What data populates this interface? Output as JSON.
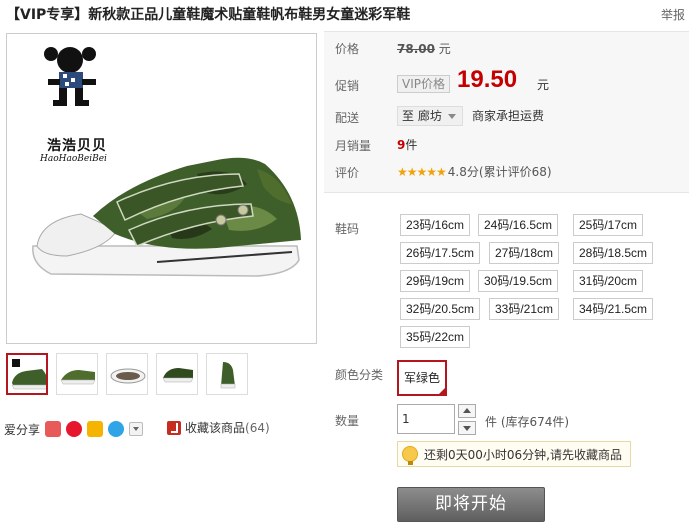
{
  "header": {
    "title": "【VIP专享】新秋款正品儿童鞋魔术贴童鞋帆布鞋男女童迷彩军鞋",
    "report_label": "举报"
  },
  "gallery": {
    "brand_name": "浩浩贝贝",
    "brand_sub": "HaoHaoBeiBei",
    "thumbnail_count": 5,
    "active_thumbnail": 1
  },
  "share": {
    "label": "爱分享",
    "favorite_label": "收藏该商品",
    "favorite_count": "(64)"
  },
  "price": {
    "price_label": "价格",
    "original_price": "78.00",
    "original_unit": "元",
    "promo_label": "促销",
    "vip_tag": "VIP价格",
    "sale_price": "19.50",
    "sale_unit": "元",
    "delivery_label": "配送",
    "delivery_to": "至 廊坊",
    "shipping_note": "商家承担运费",
    "monthly_sales_label": "月销量",
    "monthly_sales_value": "9",
    "monthly_sales_unit": "件",
    "rating_label": "评价",
    "rating_stars": "★★★★★",
    "rating_text": "4.8分(累计评价68)"
  },
  "options": {
    "size_label": "鞋码",
    "sizes": [
      "23码/16cm",
      "24码/16.5cm",
      "25码/17cm",
      "26码/17.5cm",
      "27码/18cm",
      "28码/18.5cm",
      "29码/19cm",
      "30码/19.5cm",
      "31码/20cm",
      "32码/20.5cm",
      "33码/21cm",
      "34码/21.5cm",
      "35码/22cm"
    ],
    "color_label": "颜色分类",
    "color_value": "军绿色",
    "quantity_label": "数量",
    "quantity_value": "1",
    "stock_text": "件 (库存674件)"
  },
  "notice": {
    "text": "还剩0天00小时06分钟,请先收藏商品"
  },
  "buy": {
    "button_label": "即将开始"
  },
  "colors": {
    "accent_red": "#c40000",
    "selected_border": "#b4161d",
    "button_gray": "#6f6f6f"
  }
}
